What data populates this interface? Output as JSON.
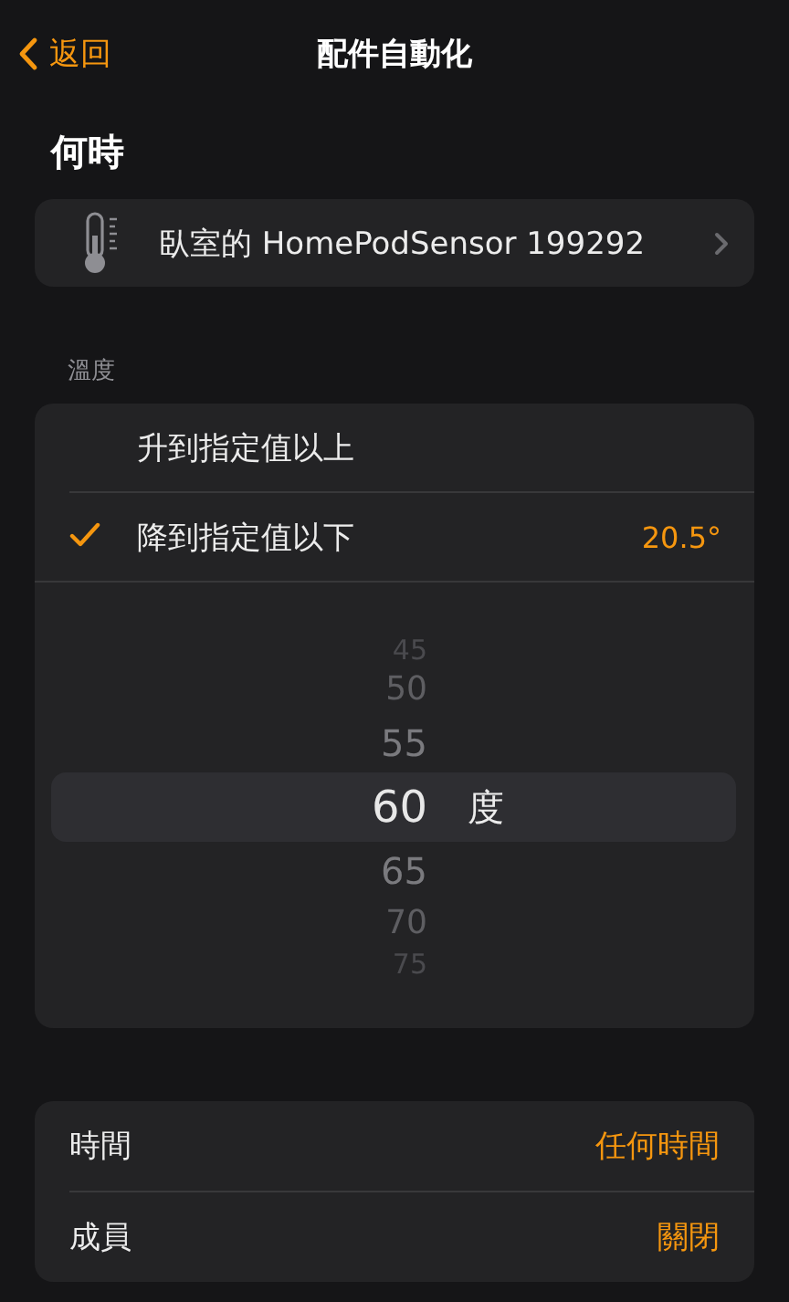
{
  "nav": {
    "back": "返回",
    "title": "配件自動化"
  },
  "section_title": "何時",
  "sensor": {
    "name": "臥室的 HomePodSensor 199292"
  },
  "temperature": {
    "header": "溫度",
    "options": [
      {
        "label": "升到指定值以上",
        "selected": false
      },
      {
        "label": "降到指定值以下",
        "selected": true,
        "value": "20.5°"
      }
    ],
    "picker": {
      "unit": "度",
      "values": [
        {
          "label": "45",
          "selected": false
        },
        {
          "label": "50",
          "selected": false
        },
        {
          "label": "55",
          "selected": false
        },
        {
          "label": "60",
          "selected": true
        },
        {
          "label": "65",
          "selected": false
        },
        {
          "label": "70",
          "selected": false
        },
        {
          "label": "75",
          "selected": false
        }
      ]
    }
  },
  "conditions": [
    {
      "label": "時間",
      "value": "任何時間"
    },
    {
      "label": "成員",
      "value": "關閉"
    }
  ]
}
